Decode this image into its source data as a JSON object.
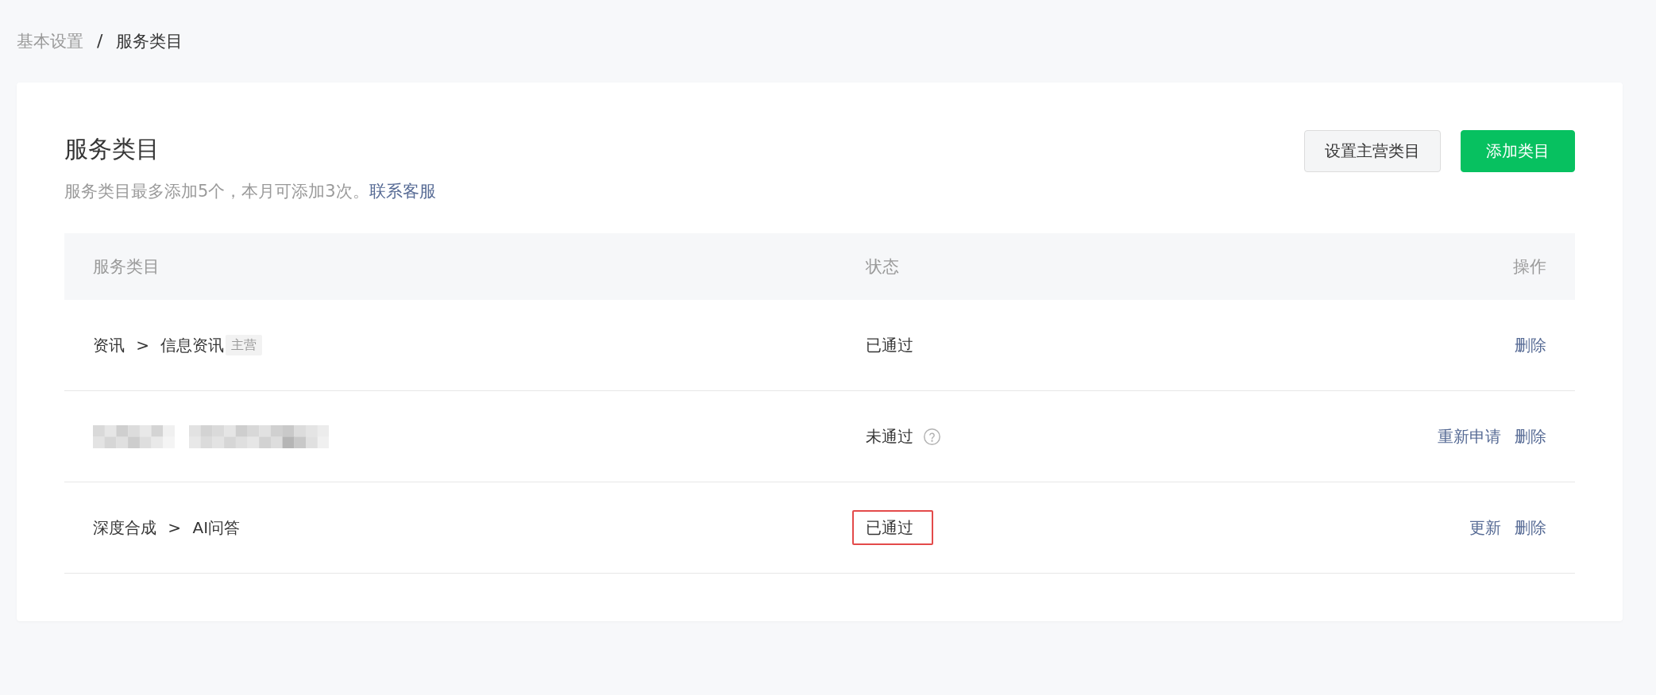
{
  "breadcrumb": {
    "separator": "/",
    "items": [
      {
        "label": "基本设置",
        "current": false
      },
      {
        "label": "服务类目",
        "current": true
      }
    ]
  },
  "page": {
    "title": "服务类目",
    "note": "服务类目最多添加5个，本月可添加3次。",
    "note_link": "联系客服",
    "buttons": [
      {
        "label": "设置主营类目",
        "kind": "secondary"
      },
      {
        "label": "添加类目",
        "kind": "primary"
      }
    ]
  },
  "table": {
    "columns": [
      "服务类目",
      "状态",
      "操作"
    ],
    "rows": [
      {
        "kind": "category",
        "category": "资讯 > 信息资讯",
        "tag": "主营",
        "status": {
          "label": "已通过",
          "help": false,
          "highlighted": false
        },
        "actions": [
          "删除"
        ]
      },
      {
        "kind": "redacted",
        "status": {
          "label": "未通过",
          "help": true,
          "highlighted": false
        },
        "actions": [
          "重新申请",
          "删除"
        ]
      },
      {
        "kind": "category",
        "category": "深度合成 > AI问答",
        "status": {
          "label": "已通过",
          "help": false,
          "highlighted": true
        },
        "actions": [
          "更新",
          "删除"
        ]
      }
    ]
  }
}
